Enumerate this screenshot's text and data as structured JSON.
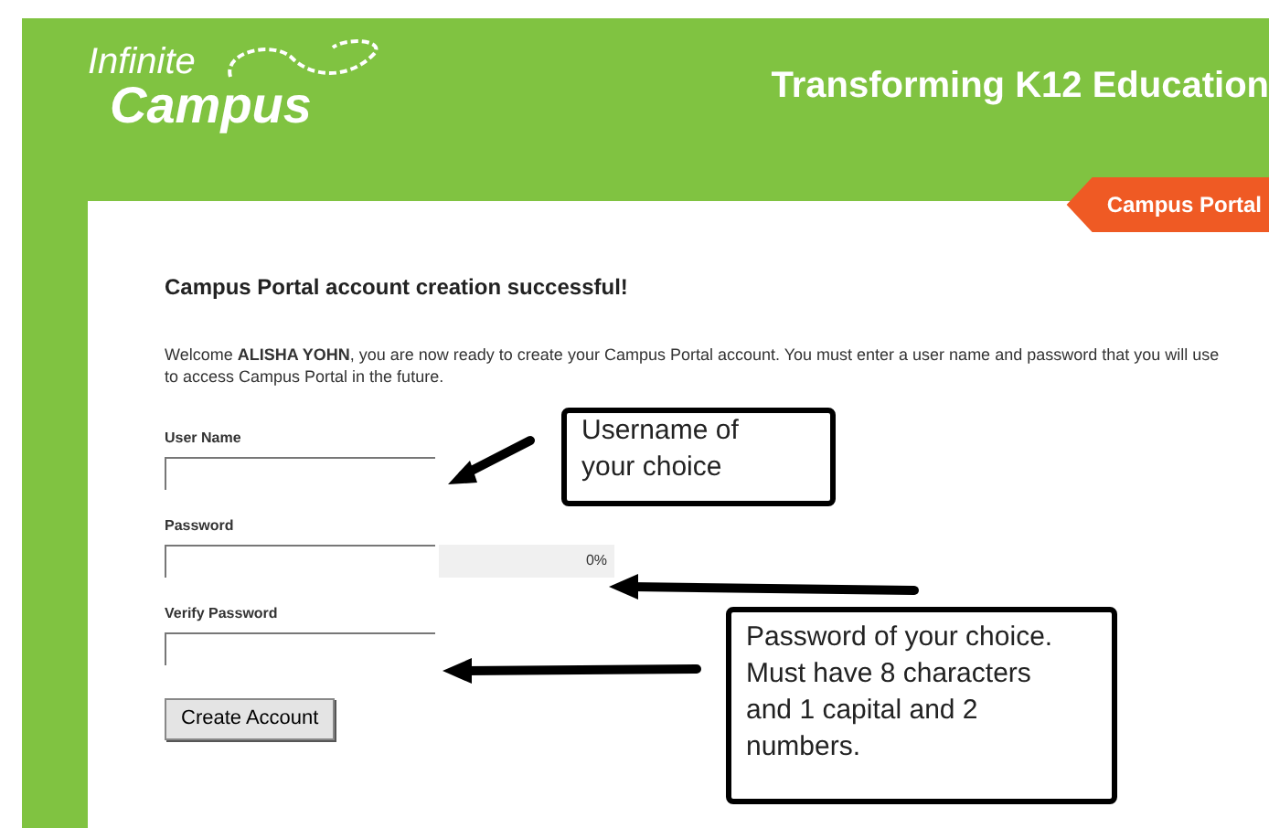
{
  "header": {
    "logo_top": "Infinite",
    "logo_bottom": "Campus",
    "tagline": "Transforming K12 Education",
    "portal_tab": "Campus Portal"
  },
  "content": {
    "heading": "Campus Portal account creation successful!",
    "welcome": "Welcome **ALISHA YOHN**, you are now ready to create your Campus Portal account. You must enter a user name and password that you will use to access Campus Portal in the future.",
    "fields": [
      {
        "label": "User Name"
      },
      {
        "label": "Password",
        "strength": {
          "level": 0,
          "reading": "0%"
        }
      },
      {
        "label": "Verify Password"
      }
    ],
    "button": "Create Account"
  },
  "callouts": [
    {
      "text": "Username of your choice"
    },
    {
      "text": "Password of your choice. Must have 8 characters and 1 capital and 2 numbers."
    }
  ]
}
